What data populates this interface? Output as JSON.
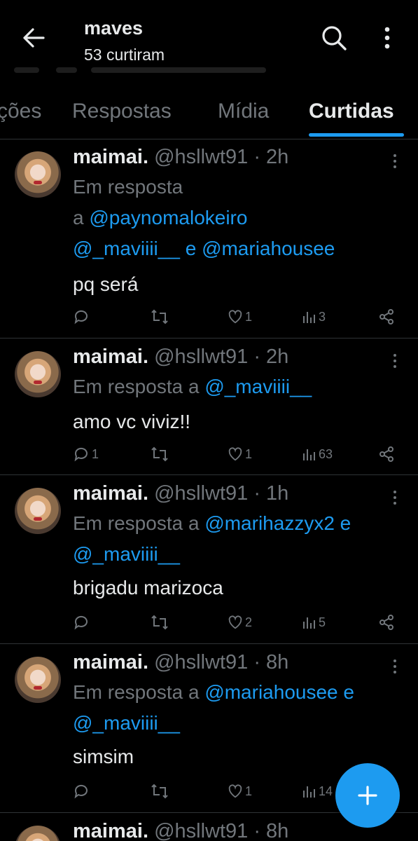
{
  "header": {
    "title": "maves",
    "subtitle": "53 curtiram"
  },
  "tabs": [
    {
      "label": "ções",
      "active": false
    },
    {
      "label": "Respostas",
      "active": false
    },
    {
      "label": "Mídia",
      "active": false
    },
    {
      "label": "Curtidas",
      "active": true
    }
  ],
  "tweets": [
    {
      "name": "maimai.",
      "handle_time": "@hsllwt91 · 2h",
      "reply_prefix": "Em resposta",
      "reply_line2_prefix": "a ",
      "reply_mention1": "@paynomalokeiro",
      "reply_mention2": "@_maviiii__",
      "reply_conj": " e ",
      "reply_mention3": "@mariahousee",
      "text": "pq será",
      "reply_count": "",
      "like_count": "1",
      "view_count": "3"
    },
    {
      "name": "maimai.",
      "handle_time": "@hsllwt91 · 2h",
      "reply_prefix": "Em resposta a ",
      "reply_mention1": "@_maviiii__",
      "text": "amo vc viviz!!",
      "reply_count": "1",
      "like_count": "1",
      "view_count": "63"
    },
    {
      "name": "maimai.",
      "handle_time": "@hsllwt91 · 1h",
      "reply_prefix": "Em resposta a ",
      "reply_mention1": "@marihazzyx2",
      "reply_conj": " e",
      "reply_mention2": "@_maviiii__",
      "text": "brigadu marizoca",
      "reply_count": "",
      "like_count": "2",
      "view_count": "5"
    },
    {
      "name": "maimai.",
      "handle_time": "@hsllwt91 · 8h",
      "reply_prefix": "Em resposta a ",
      "reply_mention1": "@mariahousee",
      "reply_conj": " e",
      "reply_mention2": "@_maviiii__",
      "text": "simsim",
      "reply_count": "",
      "like_count": "1",
      "view_count": "14"
    },
    {
      "name": "maimai.",
      "handle_time": "@hsllwt91 · 8h"
    }
  ],
  "colors": {
    "accent": "#1d9bf0",
    "background": "#000000",
    "text": "#e7e9ea",
    "muted": "#71767b",
    "divider": "#2f3336"
  },
  "icons": [
    "back-arrow-icon",
    "search-icon",
    "more-vertical-icon",
    "reply-icon",
    "retweet-icon",
    "like-icon",
    "views-icon",
    "share-icon",
    "plus-icon"
  ]
}
